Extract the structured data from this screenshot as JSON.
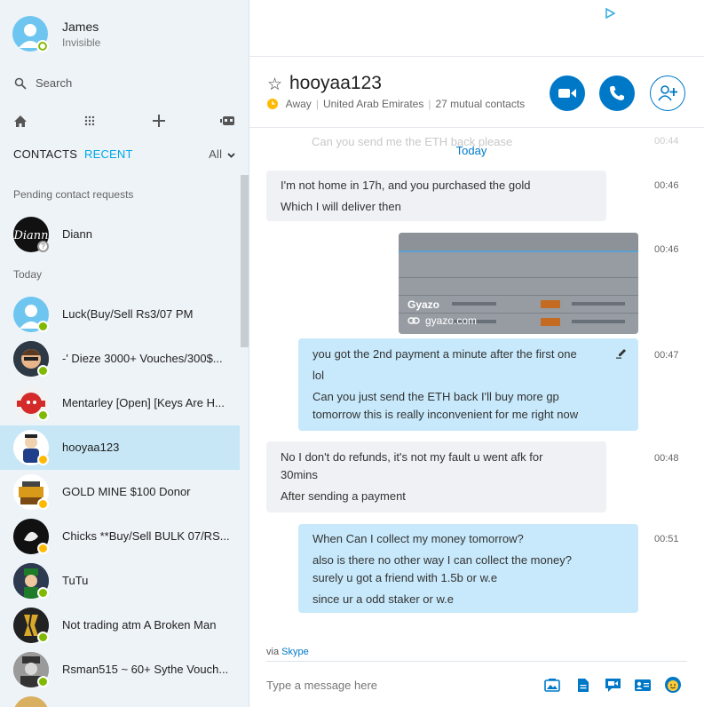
{
  "profile": {
    "name": "James",
    "status": "Invisible"
  },
  "search": {
    "placeholder": "Search"
  },
  "tabs": {
    "contacts": "CONTACTS",
    "recent": "RECENT",
    "filter": "All"
  },
  "sections": {
    "pending": "Pending contact requests",
    "today": "Today"
  },
  "pending_contact": {
    "name": "Diann"
  },
  "contacts": [
    {
      "name": "Luck(Buy/Sell Rs3/07 PM",
      "status": "online"
    },
    {
      "name": "-' Dieze 3000+ Vouches/300$...",
      "status": "online"
    },
    {
      "name": "Mentarley [Open] [Keys Are H...",
      "status": "online"
    },
    {
      "name": "hooyaa123",
      "status": "away"
    },
    {
      "name": "GOLD MINE $100 Donor",
      "status": "away"
    },
    {
      "name": "Chicks **Buy/Sell BULK 07/RS...",
      "status": "away"
    },
    {
      "name": "TuTu",
      "status": "online"
    },
    {
      "name": "Not trading atm A Broken Man",
      "status": "online"
    },
    {
      "name": "Rsman515 ~ 60+ Sythe Vouch...",
      "status": "online"
    }
  ],
  "chat": {
    "title": "hooyaa123",
    "presence": "Away",
    "location": "United Arab Emirates",
    "mutual": "27 mutual contacts",
    "day_divider": "Today",
    "ghost_message": "Can you send me the ETH back please",
    "ghost_time": "00:44",
    "messages": [
      {
        "dir": "in",
        "time": "00:46",
        "lines": [
          "I'm not home in 17h, and you purchased the gold",
          "Which I will deliver then"
        ]
      },
      {
        "dir": "out-image",
        "time": "00:46",
        "image_title": "Gyazo",
        "image_link": "gyazo.com"
      },
      {
        "dir": "out",
        "time": "00:47",
        "lines": [
          "you got the 2nd payment a minute after the first one",
          "lol",
          "Can you just send the ETH back I'll buy more gp",
          "tomorrow this is really inconvenient for me right now"
        ]
      },
      {
        "dir": "in",
        "time": "00:48",
        "lines": [
          "No I don't do refunds, it's not my fault u went afk for",
          "30mins",
          "After sending a payment"
        ]
      },
      {
        "dir": "out",
        "time": "00:51",
        "lines": [
          "When Can I collect my money tomorrow?",
          "also is there no other way I can collect the money?",
          "surely u got a friend with 1.5b or w.e",
          "since ur a odd staker or w.e"
        ]
      }
    ],
    "via_prefix": "via",
    "via_link": "Skype",
    "composer_placeholder": "Type a message here"
  },
  "colors": {
    "accent": "#0078c8",
    "out_bubble": "#c7e9fb",
    "in_bubble": "#eff1f4",
    "online": "#7fba00",
    "away": "#ffb900"
  }
}
